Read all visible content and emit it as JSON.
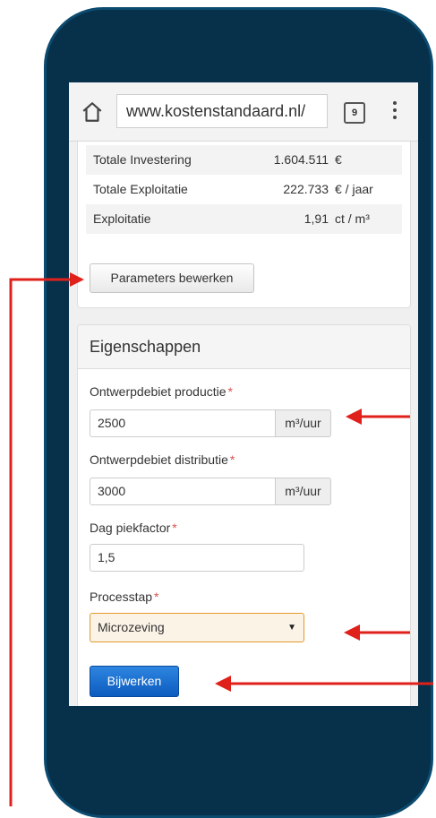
{
  "browser": {
    "url": "www.kostenstandaard.nl/",
    "tab_count": "9",
    "home_icon": "home-icon",
    "menu_icon": "more-vert-icon"
  },
  "summary": {
    "rows": [
      {
        "label": "Totale Investering",
        "value": "1.604.511",
        "unit": "€"
      },
      {
        "label": "Totale Exploitatie",
        "value": "222.733",
        "unit": "€ / jaar"
      },
      {
        "label": "Exploitatie",
        "value": "1,91",
        "unit": "ct / m³"
      }
    ],
    "edit_button": "Parameters bewerken"
  },
  "properties": {
    "title": "Eigenschappen",
    "required_mark": "*",
    "fields": {
      "production": {
        "label": "Ontwerpdebiet productie",
        "value": "2500",
        "unit": "m³/uur"
      },
      "distribution": {
        "label": "Ontwerpdebiet distributie",
        "value": "3000",
        "unit": "m³/uur"
      },
      "peak": {
        "label": "Dag piekfactor",
        "value": "1,5"
      },
      "process": {
        "label": "Processtap",
        "selected": "Microzeving"
      }
    },
    "update_button": "Bijwerken"
  },
  "colors": {
    "phone_body": "#07314b",
    "annotation_arrow": "#e0201b",
    "primary_button": "#1469cf",
    "select_highlight": "#e59a2a"
  }
}
